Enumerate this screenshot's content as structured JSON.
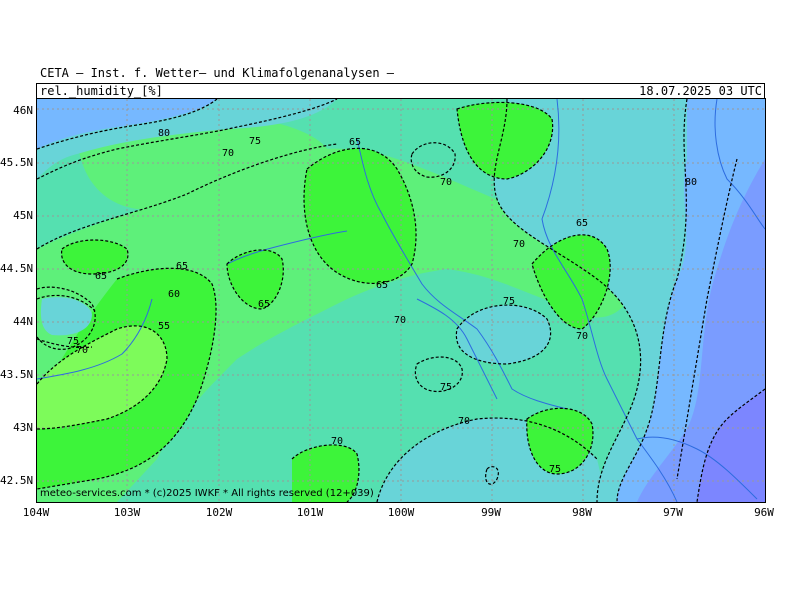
{
  "header": {
    "title": "CETA — Inst. f. Wetter— und Klimafolgenanalysen —",
    "variable": "rel._humidity_[%]",
    "valid_time": "18.07.2025 03 UTC"
  },
  "footer": {
    "copyright": "meteo-services.com * (c)2025 IWKF * All rights reserved (12+039)"
  },
  "axes": {
    "lat_labels": [
      "46N",
      "45.5N",
      "45N",
      "44.5N",
      "44N",
      "43.5N",
      "43N",
      "42.5N"
    ],
    "lon_labels": [
      "104W",
      "103W",
      "102W",
      "101W",
      "100W",
      "99W",
      "98W",
      "97W",
      "96W"
    ]
  },
  "contour_labels": [
    "80",
    "75",
    "70",
    "65",
    "65",
    "65",
    "65",
    "60",
    "55",
    "75",
    "70",
    "65",
    "70",
    "70",
    "75",
    "70",
    "75",
    "80",
    "65",
    "70",
    "70",
    "75",
    "70"
  ],
  "colors": {
    "rh_55_60": "#7dfb5a",
    "rh_60_65": "#3df43a",
    "rh_65_70": "#5ef07a",
    "rh_70_75": "#55e0b0",
    "rh_75_80": "#68d4d8",
    "rh_80_85": "#76b8ff",
    "rh_85_90": "#7a9cff",
    "rh_90_plus": "#7c86ff",
    "river": "#2d6cdf",
    "grid": "#999999"
  }
}
